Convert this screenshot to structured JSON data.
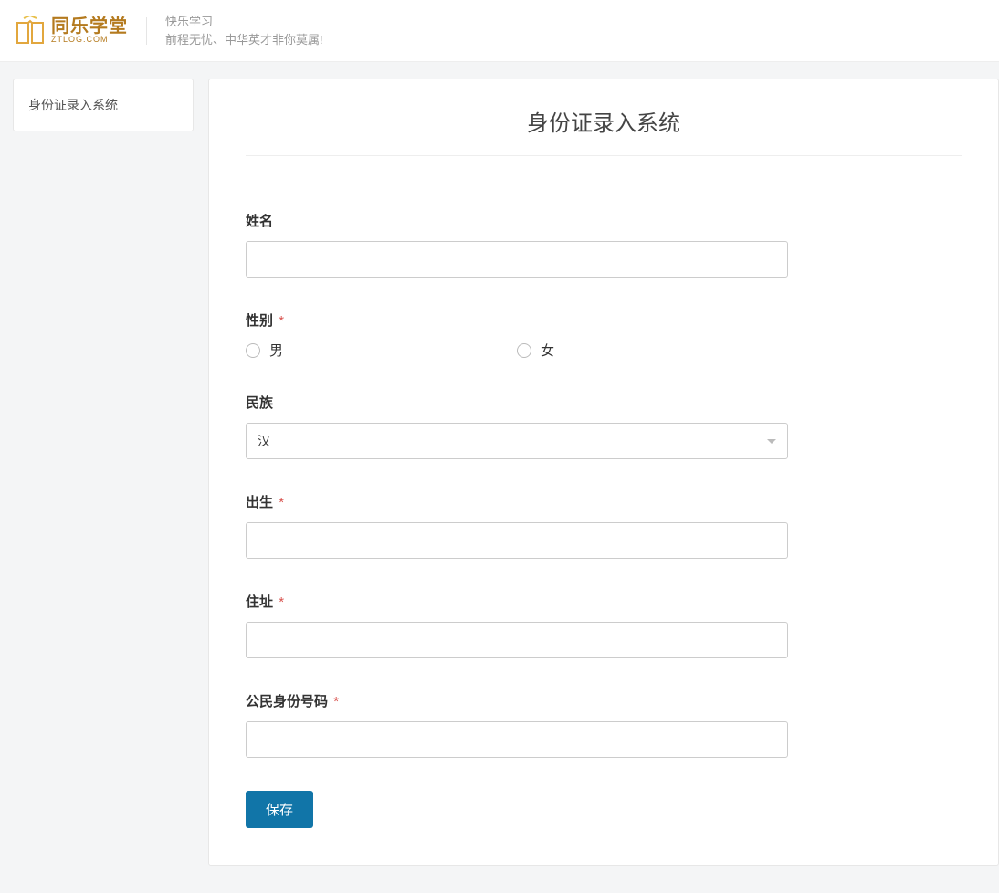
{
  "header": {
    "logo_cn": "同乐学堂",
    "logo_en": "ZTLOG.COM",
    "tagline1": "快乐学习",
    "tagline2": "前程无忧、中华英才非你莫属!"
  },
  "sidebar": {
    "items": [
      {
        "label": "身份证录入系统"
      }
    ]
  },
  "page": {
    "title": "身份证录入系统"
  },
  "form": {
    "name": {
      "label": "姓名",
      "value": ""
    },
    "gender": {
      "label": "性别",
      "required_mark": "*",
      "options": {
        "male": "男",
        "female": "女"
      }
    },
    "ethnicity": {
      "label": "民族",
      "selected": "汉"
    },
    "birth": {
      "label": "出生",
      "required_mark": "*",
      "value": ""
    },
    "address": {
      "label": "住址",
      "required_mark": "*",
      "value": ""
    },
    "id_number": {
      "label": "公民身份号码",
      "required_mark": "*",
      "value": ""
    },
    "submit_label": "保存"
  }
}
